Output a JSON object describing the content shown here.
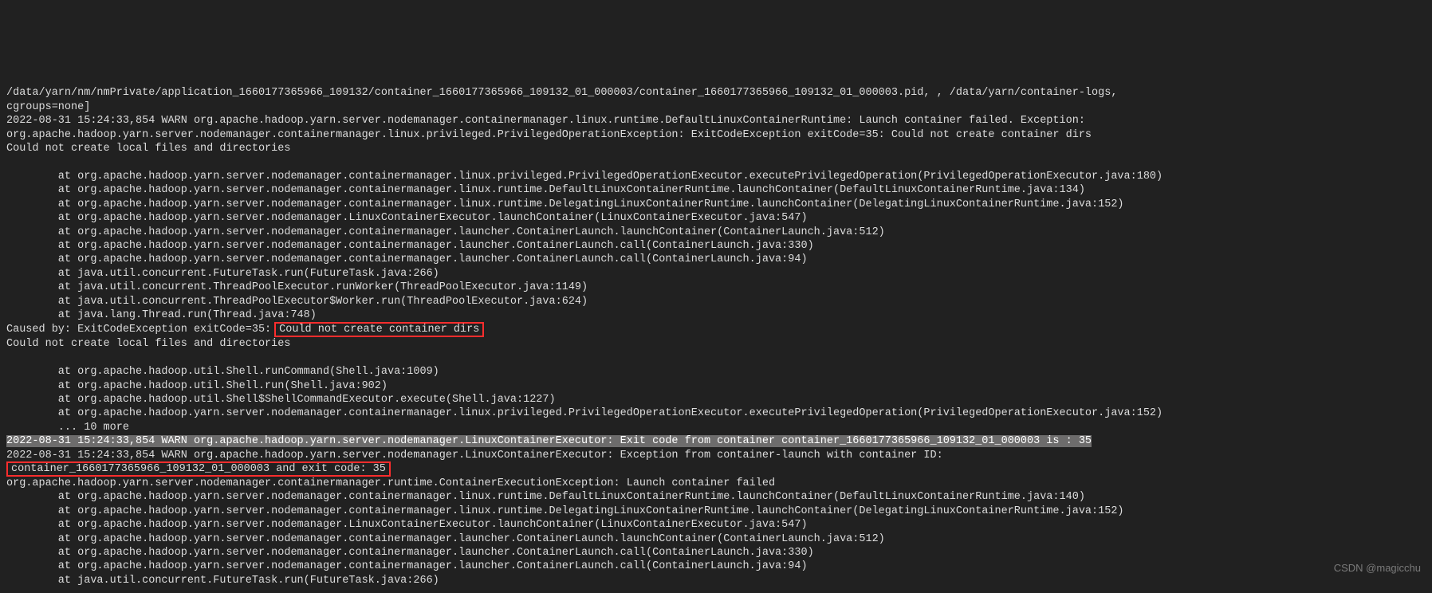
{
  "log": {
    "header": "/data/yarn/nm/nmPrivate/application_1660177365966_109132/container_1660177365966_109132_01_000003/container_1660177365966_109132_01_000003.pid, , /data/yarn/container-logs,",
    "header2": "cgroups=none]",
    "warn1_a": "2022-08-31 15:24:33,854 WARN org.apache.hadoop.yarn.server.nodemanager.containermanager.linux.runtime.DefaultLinuxContainerRuntime: Launch container failed. Exception:",
    "warn1_b": "org.apache.hadoop.yarn.server.nodemanager.containermanager.linux.privileged.PrivilegedOperationException: ExitCodeException exitCode=35: Could not create container dirs",
    "warn1_c": "Could not create local files and directories",
    "stack1": [
      "        at org.apache.hadoop.yarn.server.nodemanager.containermanager.linux.privileged.PrivilegedOperationExecutor.executePrivilegedOperation(PrivilegedOperationExecutor.java:180)",
      "        at org.apache.hadoop.yarn.server.nodemanager.containermanager.linux.runtime.DefaultLinuxContainerRuntime.launchContainer(DefaultLinuxContainerRuntime.java:134)",
      "        at org.apache.hadoop.yarn.server.nodemanager.containermanager.linux.runtime.DelegatingLinuxContainerRuntime.launchContainer(DelegatingLinuxContainerRuntime.java:152)",
      "        at org.apache.hadoop.yarn.server.nodemanager.LinuxContainerExecutor.launchContainer(LinuxContainerExecutor.java:547)",
      "        at org.apache.hadoop.yarn.server.nodemanager.containermanager.launcher.ContainerLaunch.launchContainer(ContainerLaunch.java:512)",
      "        at org.apache.hadoop.yarn.server.nodemanager.containermanager.launcher.ContainerLaunch.call(ContainerLaunch.java:330)",
      "        at org.apache.hadoop.yarn.server.nodemanager.containermanager.launcher.ContainerLaunch.call(ContainerLaunch.java:94)",
      "        at java.util.concurrent.FutureTask.run(FutureTask.java:266)",
      "        at java.util.concurrent.ThreadPoolExecutor.runWorker(ThreadPoolExecutor.java:1149)",
      "        at java.util.concurrent.ThreadPoolExecutor$Worker.run(ThreadPoolExecutor.java:624)",
      "        at java.lang.Thread.run(Thread.java:748)"
    ],
    "caused_prefix": "Caused by: ExitCodeException exitCode=35:",
    "caused_highlight": "Could not create container dirs",
    "caused_after": "Could not create local files and directories",
    "stack2": [
      "        at org.apache.hadoop.util.Shell.runCommand(Shell.java:1009)",
      "        at org.apache.hadoop.util.Shell.run(Shell.java:902)",
      "        at org.apache.hadoop.util.Shell$ShellCommandExecutor.execute(Shell.java:1227)",
      "        at org.apache.hadoop.yarn.server.nodemanager.containermanager.linux.privileged.PrivilegedOperationExecutor.executePrivilegedOperation(PrivilegedOperationExecutor.java:152)",
      "        ... 10 more"
    ],
    "selected_line": "2022-08-31 15:24:33,854 WARN org.apache.hadoop.yarn.server.nodemanager.LinuxContainerExecutor: Exit code from container container_1660177365966_109132_01_000003 is : 35",
    "warn2": "2022-08-31 15:24:33,854 WARN org.apache.hadoop.yarn.server.nodemanager.LinuxContainerExecutor: Exception from container-launch with container ID:",
    "boxed2": "container_1660177365966_109132_01_000003 and exit code: 35",
    "exc_line": "org.apache.hadoop.yarn.server.nodemanager.containermanager.runtime.ContainerExecutionException: Launch container failed",
    "stack3": [
      "        at org.apache.hadoop.yarn.server.nodemanager.containermanager.linux.runtime.DefaultLinuxContainerRuntime.launchContainer(DefaultLinuxContainerRuntime.java:140)",
      "        at org.apache.hadoop.yarn.server.nodemanager.containermanager.linux.runtime.DelegatingLinuxContainerRuntime.launchContainer(DelegatingLinuxContainerRuntime.java:152)",
      "        at org.apache.hadoop.yarn.server.nodemanager.LinuxContainerExecutor.launchContainer(LinuxContainerExecutor.java:547)",
      "        at org.apache.hadoop.yarn.server.nodemanager.containermanager.launcher.ContainerLaunch.launchContainer(ContainerLaunch.java:512)",
      "        at org.apache.hadoop.yarn.server.nodemanager.containermanager.launcher.ContainerLaunch.call(ContainerLaunch.java:330)",
      "        at org.apache.hadoop.yarn.server.nodemanager.containermanager.launcher.ContainerLaunch.call(ContainerLaunch.java:94)",
      "        at java.util.concurrent.FutureTask.run(FutureTask.java:266)"
    ]
  },
  "watermark": "CSDN @magicchu"
}
